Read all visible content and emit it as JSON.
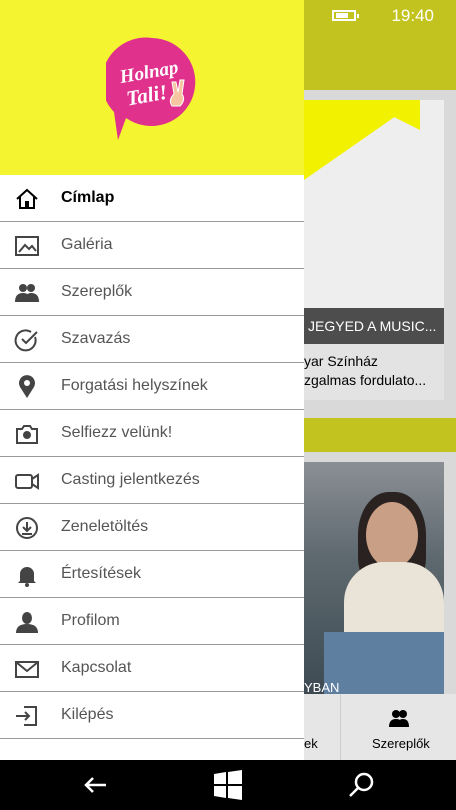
{
  "status_bar": {
    "time": "19:40",
    "icons": [
      "notification-icon",
      "notification-icon",
      "wifi-icon",
      "data-icon",
      "battery-icon"
    ]
  },
  "background_content": {
    "card1_banner": "JEGYED A MUSIC...",
    "card1_line1": "yar Színház",
    "card1_line2": "zgalmas fordulato...",
    "photo_caption": "YBAN",
    "bottom_nav_left_partial": "ek",
    "bottom_nav_right": "Szereplők"
  },
  "drawer": {
    "logo_text_line1": "Holnap",
    "logo_text_line2": "Tali!",
    "items": [
      {
        "label": "Címlap",
        "icon": "home-icon",
        "active": true
      },
      {
        "label": "Galéria",
        "icon": "gallery-icon"
      },
      {
        "label": "Szereplők",
        "icon": "people-icon"
      },
      {
        "label": "Szavazás",
        "icon": "check-circle-icon"
      },
      {
        "label": "Forgatási helyszínek",
        "icon": "location-pin-icon"
      },
      {
        "label": "Selfiezz velünk!",
        "icon": "camera-icon"
      },
      {
        "label": "Casting jelentkezés",
        "icon": "video-camera-icon"
      },
      {
        "label": "Zeneletöltés",
        "icon": "download-icon"
      },
      {
        "label": "Értesítések",
        "icon": "bell-icon"
      },
      {
        "label": "Profilom",
        "icon": "profile-icon"
      },
      {
        "label": "Kapcsolat",
        "icon": "mail-icon"
      },
      {
        "label": "Kilépés",
        "icon": "sign-out-icon"
      }
    ]
  },
  "colors": {
    "drawer_header": "#f4f431",
    "app_accent": "#c3c31f",
    "logo_pink": "#e0318c"
  }
}
